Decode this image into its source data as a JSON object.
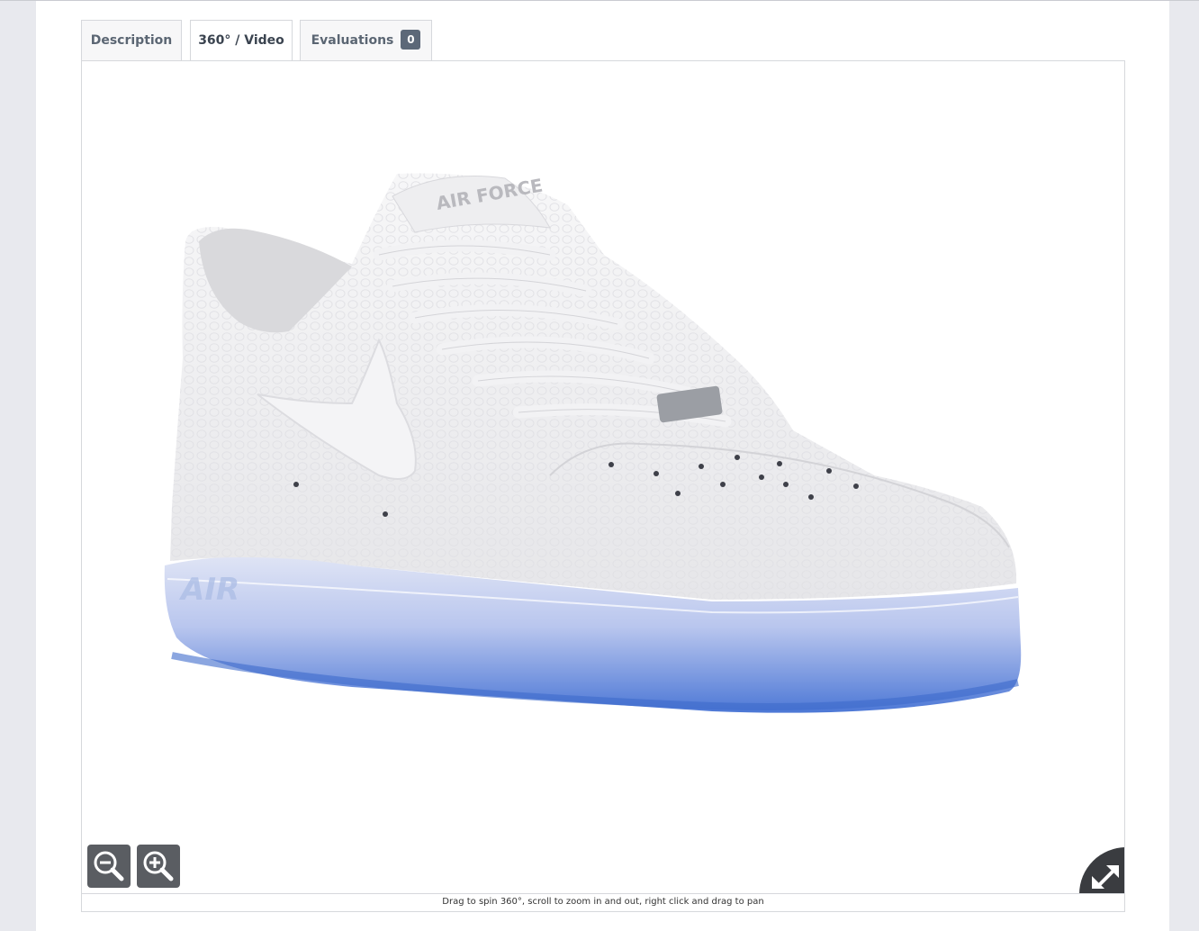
{
  "tabs": [
    {
      "label": "Description",
      "active": false
    },
    {
      "label": "360° / Video",
      "active": true
    },
    {
      "label": "Evaluations",
      "count": "0",
      "active": false
    }
  ],
  "viewer": {
    "product_image": "white leather sneaker with translucent blue sole",
    "controls": {
      "zoom_out_icon": "zoom-out-magnifier-icon",
      "zoom_in_icon": "zoom-in-magnifier-icon",
      "fullscreen_icon": "expand-arrows-icon"
    },
    "hint": "Drag to spin 360°, scroll to zoom in and out, right click and drag to pan"
  },
  "colors": {
    "tab_badge": "#5c6878",
    "control_buttons": "#5a5d62",
    "fullscreen_button": "#3a3c40",
    "sole_blue": "#5f86d8"
  }
}
